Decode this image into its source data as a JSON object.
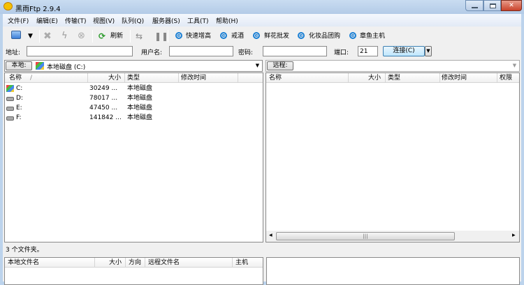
{
  "window": {
    "title": "黑雨Ftp 2.9.4"
  },
  "menu": [
    "文件(F)",
    "编辑(E)",
    "传输(T)",
    "视图(V)",
    "队列(Q)",
    "服务器(S)",
    "工具(T)",
    "帮助(H)"
  ],
  "toolbar": {
    "refresh": "刷新",
    "links": [
      "快速增高",
      "戒酒",
      "鲜花批发",
      "化妆品团购",
      "章鱼主机"
    ]
  },
  "connect": {
    "address_label": "地址:",
    "address": "",
    "user_label": "用户名:",
    "user": "",
    "password_label": "密码:",
    "password": "",
    "port_label": "端口:",
    "port": "21",
    "connect_button": "连接(C)"
  },
  "local": {
    "label": "本地:",
    "path": "本地磁盘 (C:)",
    "columns": [
      "名称",
      "大小",
      "类型",
      "修改时间"
    ],
    "rows": [
      {
        "name": "C:",
        "size": "30249 ...",
        "type": "本地磁盘"
      },
      {
        "name": "D:",
        "size": "78017 ...",
        "type": "本地磁盘"
      },
      {
        "name": "E:",
        "size": "47450 ...",
        "type": "本地磁盘"
      },
      {
        "name": "F:",
        "size": "141842 ...",
        "type": "本地磁盘"
      }
    ],
    "status": "3 个文件夹。"
  },
  "remote": {
    "label": "远程:",
    "path": "",
    "columns": [
      "名称",
      "大小",
      "类型",
      "修改时间",
      "权限"
    ]
  },
  "queue": {
    "columns": [
      "本地文件名",
      "大小",
      "方向",
      "远程文件名",
      "主机"
    ]
  }
}
